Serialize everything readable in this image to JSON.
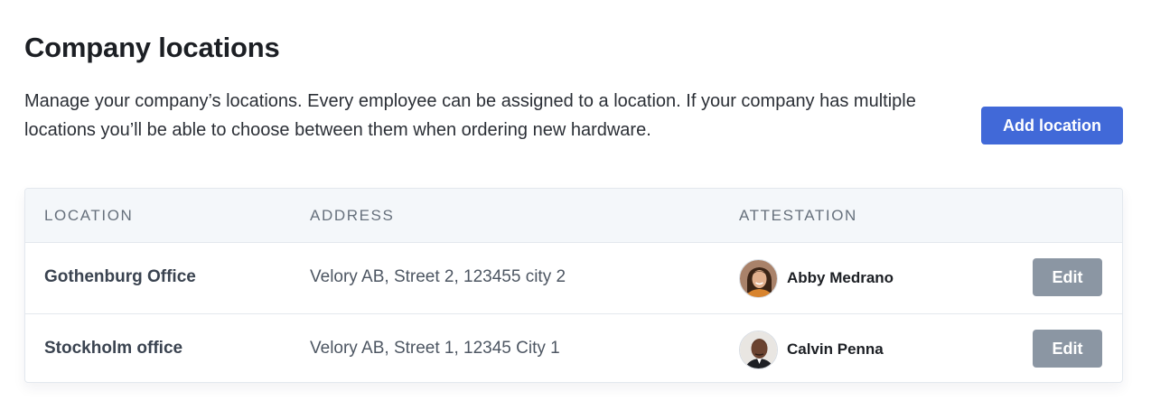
{
  "header": {
    "title": "Company locations",
    "description": "Manage your company’s locations. Every employee can be assigned to a location. If your company has multiple locations you’ll be able to choose between them when ordering new hardware.",
    "add_label": "Add location"
  },
  "table": {
    "columns": [
      "LOCATION",
      "ADDRESS",
      "ATTESTATION"
    ],
    "rows": [
      {
        "location": "Gothenburg Office",
        "address": "Velory AB, Street 2, 123455 city 2",
        "attestation": "Abby Medrano",
        "avatar_icon": "avatar-woman-icon",
        "edit_label": "Edit"
      },
      {
        "location": "Stockholm office",
        "address": "Velory AB, Street 1, 12345 City 1",
        "attestation": "Calvin Penna",
        "avatar_icon": "avatar-man-icon",
        "edit_label": "Edit"
      }
    ]
  },
  "colors": {
    "primary": "#4169d8",
    "edit_button": "#8b96a3",
    "header_bg": "#f4f7fa",
    "border": "#e3e8ee"
  }
}
